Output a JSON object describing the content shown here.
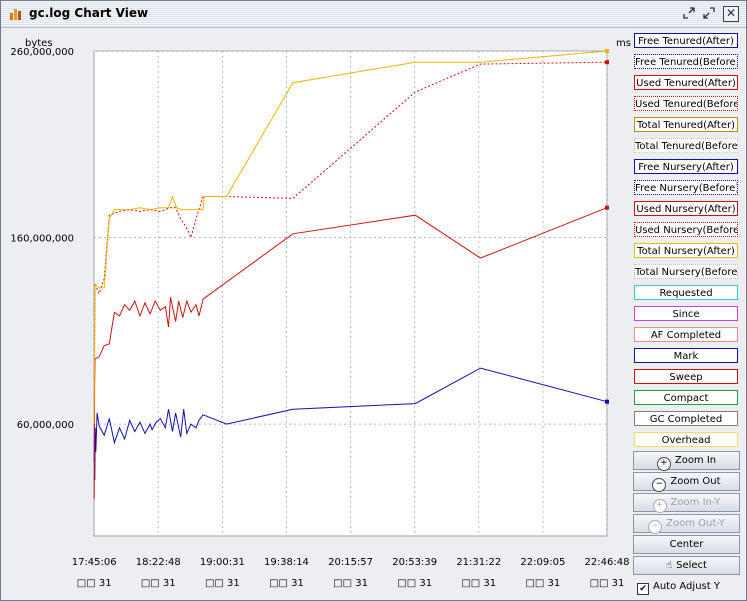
{
  "window": {
    "title": "gc.log Chart View"
  },
  "chart_data": {
    "type": "line",
    "y_unit_left": "bytes",
    "y_unit_right": "ms",
    "ylim": [
      0,
      260000000
    ],
    "y_ticks": [
      {
        "label": "260,000,000",
        "value": 260000000
      },
      {
        "label": "160,000,000",
        "value": 160000000
      },
      {
        "label": "60,000,000",
        "value": 60000000
      }
    ],
    "x_ticks": [
      {
        "time": "17:45:06",
        "date": "□□ 31"
      },
      {
        "time": "18:22:48",
        "date": "□□ 31"
      },
      {
        "time": "19:00:31",
        "date": "□□ 31"
      },
      {
        "time": "19:38:14",
        "date": "□□ 31"
      },
      {
        "time": "20:15:57",
        "date": "□□ 31"
      },
      {
        "time": "20:53:39",
        "date": "□□ 31"
      },
      {
        "time": "21:31:22",
        "date": "□□ 31"
      },
      {
        "time": "22:09:05",
        "date": "□□ 31"
      },
      {
        "time": "22:46:48",
        "date": "□□ 31"
      }
    ],
    "series": [
      {
        "name": "Free Tenured(After)",
        "color": "#1010b0",
        "dash": false,
        "points": [
          [
            17.752,
            40000000
          ],
          [
            17.755,
            60000000
          ],
          [
            17.758,
            30000000
          ],
          [
            17.762,
            58000000
          ],
          [
            17.768,
            45000000
          ],
          [
            17.78,
            66000000
          ],
          [
            17.8,
            59000000
          ],
          [
            17.85,
            54000000
          ],
          [
            17.9,
            63000000
          ],
          [
            17.95,
            50000000
          ],
          [
            18.0,
            58000000
          ],
          [
            18.05,
            52000000
          ],
          [
            18.1,
            62000000
          ],
          [
            18.15,
            56000000
          ],
          [
            18.2,
            61000000
          ],
          [
            18.25,
            55000000
          ],
          [
            18.3,
            60000000
          ],
          [
            18.32,
            57000000
          ],
          [
            18.36,
            61000000
          ],
          [
            18.4,
            63000000
          ],
          [
            18.45,
            58000000
          ],
          [
            18.48,
            68000000
          ],
          [
            18.52,
            56000000
          ],
          [
            18.55,
            66000000
          ],
          [
            18.58,
            58000000
          ],
          [
            18.6,
            53000000
          ],
          [
            18.63,
            68000000
          ],
          [
            18.66,
            55000000
          ],
          [
            18.7,
            60000000
          ],
          [
            18.75,
            58000000
          ],
          [
            18.78,
            62000000
          ],
          [
            18.82,
            65000000
          ],
          [
            19.05,
            60000000
          ],
          [
            19.7,
            68000000
          ],
          [
            20.9,
            71000000
          ],
          [
            21.54,
            90000000
          ],
          [
            22.78,
            72000000
          ]
        ]
      },
      {
        "name": "Used Tenured(After)",
        "color": "#d01010",
        "dash": false,
        "points": [
          [
            17.752,
            20000000
          ],
          [
            17.756,
            80000000
          ],
          [
            17.76,
            95000000
          ],
          [
            17.8,
            96000000
          ],
          [
            17.85,
            102000000
          ],
          [
            17.9,
            103000000
          ],
          [
            17.95,
            120000000
          ],
          [
            18.0,
            118000000
          ],
          [
            18.05,
            124000000
          ],
          [
            18.1,
            121000000
          ],
          [
            18.15,
            126000000
          ],
          [
            18.2,
            118000000
          ],
          [
            18.25,
            125000000
          ],
          [
            18.3,
            119000000
          ],
          [
            18.35,
            126000000
          ],
          [
            18.4,
            121000000
          ],
          [
            18.45,
            123000000
          ],
          [
            18.48,
            112000000
          ],
          [
            18.5,
            128000000
          ],
          [
            18.55,
            115000000
          ],
          [
            18.58,
            126000000
          ],
          [
            18.62,
            117000000
          ],
          [
            18.66,
            126000000
          ],
          [
            18.7,
            120000000
          ],
          [
            18.75,
            124000000
          ],
          [
            18.78,
            118000000
          ],
          [
            18.82,
            127000000
          ],
          [
            19.7,
            162000000
          ],
          [
            20.9,
            172000000
          ],
          [
            21.54,
            149000000
          ],
          [
            22.78,
            176000000
          ]
        ]
      },
      {
        "name": "Used Tenured(Before)",
        "color": "#d01010",
        "dash": true,
        "points": [
          [
            17.752,
            60000000
          ],
          [
            17.756,
            95000000
          ],
          [
            17.76,
            135000000
          ],
          [
            17.8,
            130000000
          ],
          [
            17.85,
            138000000
          ],
          [
            17.9,
            172000000
          ],
          [
            18.0,
            174000000
          ],
          [
            18.1,
            175000000
          ],
          [
            18.2,
            174000000
          ],
          [
            18.3,
            175000000
          ],
          [
            18.4,
            174000000
          ],
          [
            18.5,
            176000000
          ],
          [
            18.55,
            176000000
          ],
          [
            18.6,
            170000000
          ],
          [
            18.66,
            165000000
          ],
          [
            18.7,
            160000000
          ],
          [
            18.75,
            170000000
          ],
          [
            18.82,
            182000000
          ],
          [
            19.05,
            182000000
          ],
          [
            19.7,
            181000000
          ],
          [
            20.9,
            238000000
          ],
          [
            21.54,
            253000000
          ],
          [
            22.78,
            254000000
          ]
        ]
      },
      {
        "name": "Total Tenured(After)",
        "color": "#f0b400",
        "dash": false,
        "points": [
          [
            17.75,
            60000000
          ],
          [
            17.76,
            135000000
          ],
          [
            17.8,
            133000000
          ],
          [
            17.85,
            133000000
          ],
          [
            17.9,
            170000000
          ],
          [
            17.95,
            175000000
          ],
          [
            18.0,
            175000000
          ],
          [
            18.1,
            175000000
          ],
          [
            18.2,
            176000000
          ],
          [
            18.3,
            175000000
          ],
          [
            18.4,
            176000000
          ],
          [
            18.48,
            176000000
          ],
          [
            18.52,
            182000000
          ],
          [
            18.56,
            176000000
          ],
          [
            18.6,
            175000000
          ],
          [
            18.7,
            175000000
          ],
          [
            18.82,
            175000000
          ],
          [
            18.83,
            182000000
          ],
          [
            19.05,
            182000000
          ],
          [
            19.7,
            243000000
          ],
          [
            20.9,
            254000000
          ],
          [
            21.54,
            254000000
          ],
          [
            22.78,
            260000000
          ]
        ]
      }
    ]
  },
  "legend": {
    "items": [
      {
        "label": "Free Tenured(After)",
        "color": "#1010b0",
        "state": "on"
      },
      {
        "label": "Free Tenured(Before)",
        "color": "#1010b0",
        "state": "off"
      },
      {
        "label": "Used Tenured(After)",
        "color": "#d01010",
        "state": "on"
      },
      {
        "label": "Used Tenured(Before)",
        "color": "#d01010",
        "state": "off"
      },
      {
        "label": "Total Tenured(After)",
        "color": "#c09000",
        "state": "on"
      },
      {
        "label": "Total Tenured(Before)",
        "color": "#c0c0c0",
        "state": "off"
      },
      {
        "label": "Free Nursery(After)",
        "color": "#1010b0",
        "state": "on"
      },
      {
        "label": "Free Nursery(Before)",
        "color": "#1010b0",
        "state": "off"
      },
      {
        "label": "Used Nursery(After)",
        "color": "#d01010",
        "state": "on"
      },
      {
        "label": "Used Nursery(Before)",
        "color": "#d01010",
        "state": "off"
      },
      {
        "label": "Total Nursery(After)",
        "color": "#e0c000",
        "state": "on"
      },
      {
        "label": "Total Nursery(Before)",
        "color": "#c0c0c0",
        "state": "off"
      },
      {
        "label": "Requested",
        "color": "#30c8d8",
        "state": "on"
      },
      {
        "label": "Since",
        "color": "#d040d0",
        "state": "on"
      },
      {
        "label": "AF Completed",
        "color": "#e09090",
        "state": "on"
      },
      {
        "label": "Mark",
        "color": "#1010b0",
        "state": "on"
      },
      {
        "label": "Sweep",
        "color": "#d01010",
        "state": "on"
      },
      {
        "label": "Compact",
        "color": "#20a040",
        "state": "on"
      },
      {
        "label": "GC Completed",
        "color": "#808080",
        "state": "on"
      },
      {
        "label": "Overhead",
        "color": "#f0e060",
        "state": "on"
      }
    ]
  },
  "controls": {
    "zoom_in": "Zoom In",
    "zoom_out": "Zoom Out",
    "zoom_in_y": "Zoom In-Y",
    "zoom_out_y": "Zoom Out-Y",
    "center": "Center",
    "select": "Select",
    "auto_adjust": "Auto Adjust Y",
    "auto_adjust_checked": true
  }
}
